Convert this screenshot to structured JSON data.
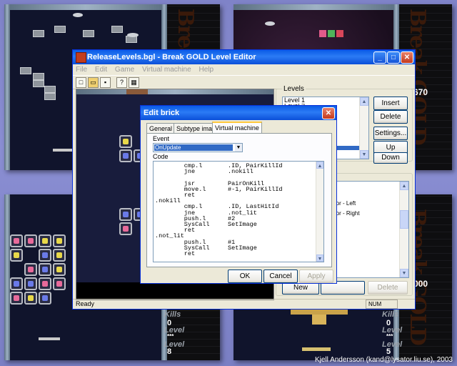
{
  "editor": {
    "title": "ReleaseLevels.bgl - Break GOLD Level Editor",
    "menu": [
      "File",
      "Edit",
      "Game",
      "Virtual machine",
      "Help"
    ],
    "levels_label": "Levels",
    "levels": [
      "Level 1",
      "Level 2"
    ],
    "level_buttons": {
      "insert": "Insert",
      "delete": "Delete",
      "settings": "Settings...",
      "up": "Up",
      "down": "Down"
    },
    "items": [
      "ator - Left",
      "ator - Right"
    ],
    "bottom_buttons": {
      "new": "New",
      "delete": "Delete"
    },
    "status": {
      "ready": "Ready",
      "num": "NUM"
    }
  },
  "dialog": {
    "title": "Edit brick",
    "tabs": [
      "General",
      "Subtype images",
      "Virtual machine"
    ],
    "event_label": "Event",
    "event_value": "OnUpdate",
    "code_label": "Code",
    "code": "        cmp.l       .ID, PairKillId\n        jne         .nokill\n\n        jsr         PairOnKill\n        move.l      #-1, PairKillId\n        ret\n.nokill\n        cmp.l       .ID, LastHitId\n        jne         .not_lit\n        push.l      #2\n        SysCall     SetImage\n        ret\n.not_lit\n        push.l      #1\n        SysCall     SetImage\n        ret",
    "buttons": {
      "ok": "OK",
      "cancel": "Cancel",
      "apply": "Apply"
    }
  },
  "games": {
    "top_right_score": "670",
    "bottom_right_score": "000",
    "left_stats": {
      "kills_label": "Kills",
      "kills": "0",
      "level_label": "Level",
      "level_dots": "***",
      "level2_label": "Level",
      "level": "8"
    },
    "right_stats": {
      "kills_label": "Kills",
      "kills": "0",
      "level_label": "Level",
      "level_dots": "***",
      "level2_label": "Level",
      "level": "5"
    },
    "logo": "Break GOLD"
  },
  "credit": "Kjell Andersson (kand@lysator.liu.se), 2003",
  "colors": {
    "titlebar": "#0a5be6",
    "selection": "#316ac5",
    "window": "#ece9d8"
  }
}
